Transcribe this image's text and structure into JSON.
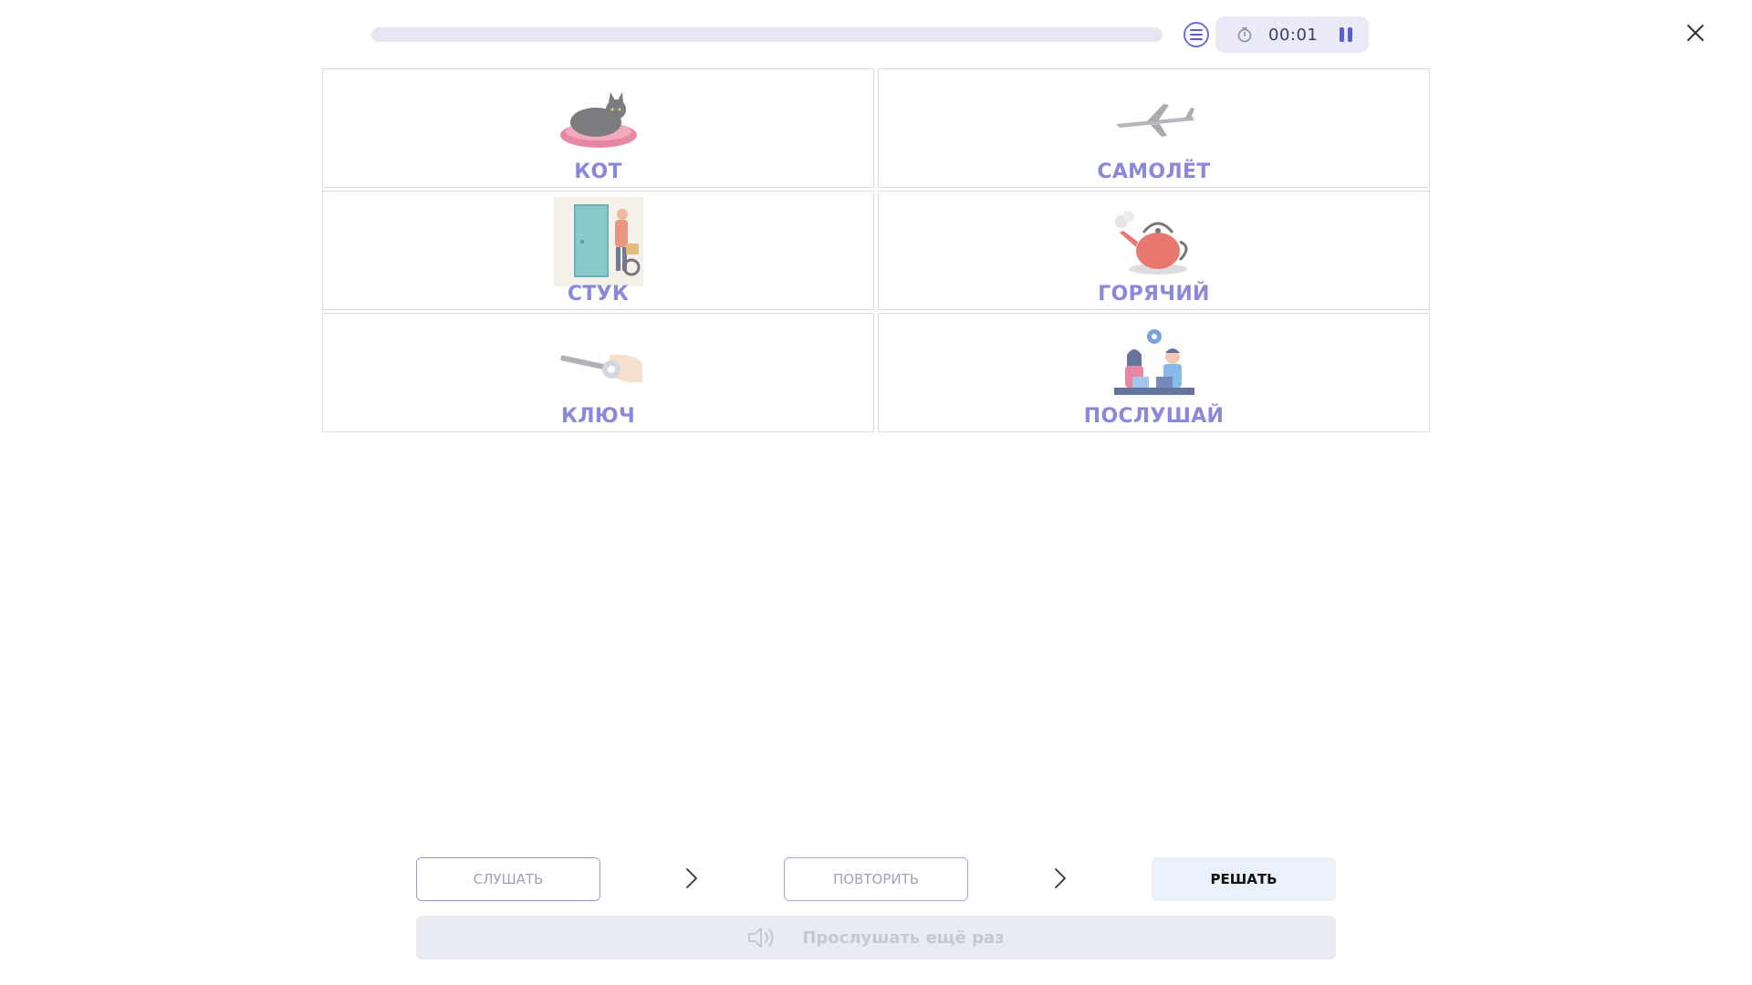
{
  "header": {
    "progress": 0.0,
    "list_icon": "list-icon",
    "timer_icon": "stopwatch-icon",
    "timer": "00:01",
    "pause_icon": "pause-icon",
    "close_icon": "close-icon"
  },
  "cards": [
    {
      "label": "КОТ",
      "image": "cat-image"
    },
    {
      "label": "САМОЛЁТ",
      "image": "airplane-image"
    },
    {
      "label": "СТУК",
      "image": "knock-door-image"
    },
    {
      "label": "ГОРЯЧИЙ",
      "image": "teapot-image"
    },
    {
      "label": "КЛЮЧ",
      "image": "key-image"
    },
    {
      "label": "ПОСЛУШАЙ",
      "image": "people-talking-image"
    }
  ],
  "steps": {
    "listen": "СЛУШАТЬ",
    "repeat": "ПОВТОРИТЬ",
    "solve": "РЕШАТЬ",
    "arrow_icon": "chevron-right-icon"
  },
  "replay": {
    "icon": "speaker-icon",
    "label": "Прослушать ещё раз"
  },
  "colors": {
    "accent": "#6b6fd6",
    "label": "#8a88d8",
    "solve_bg": "#eaf1fb"
  }
}
